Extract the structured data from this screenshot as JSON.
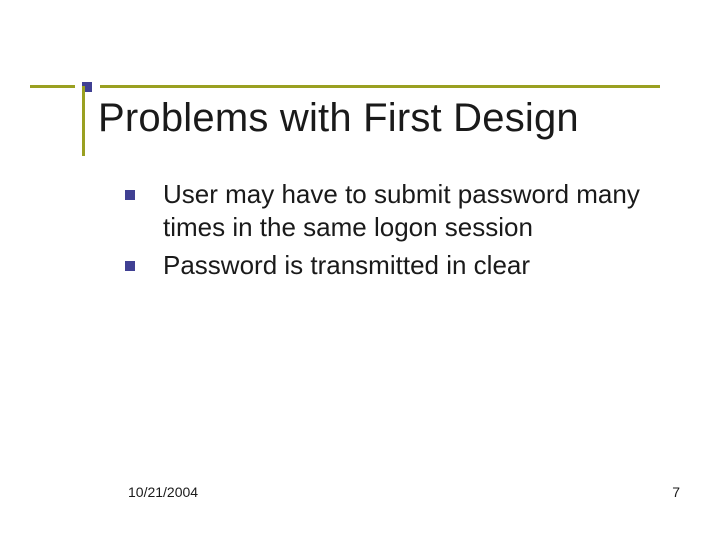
{
  "title": "Problems with First Design",
  "bullets": [
    "User may have to submit password many times in the same logon session",
    "Password is transmitted in clear"
  ],
  "footer": {
    "date": "10/21/2004",
    "page": "7"
  }
}
